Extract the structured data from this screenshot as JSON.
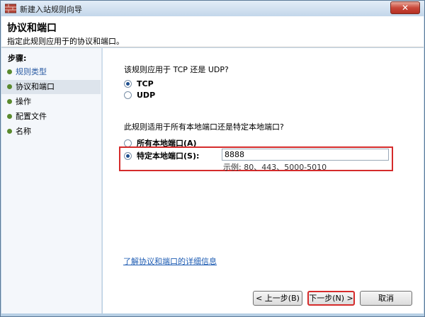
{
  "window": {
    "title": "新建入站规则向导",
    "close_glyph": "✕"
  },
  "header": {
    "title": "协议和端口",
    "subtitle": "指定此规则应用于的协议和端口。"
  },
  "steps": {
    "title": "步骤:",
    "items": [
      {
        "label": "规则类型",
        "state": "done"
      },
      {
        "label": "协议和端口",
        "state": "active"
      },
      {
        "label": "操作",
        "state": "pending"
      },
      {
        "label": "配置文件",
        "state": "pending"
      },
      {
        "label": "名称",
        "state": "pending"
      }
    ]
  },
  "protocol": {
    "question": "该规则应用于 TCP 还是 UDP?",
    "options": [
      {
        "label": "TCP",
        "checked": true
      },
      {
        "label": "UDP",
        "checked": false
      }
    ]
  },
  "ports": {
    "question": "此规则适用于所有本地端口还是特定本地端口?",
    "all_label": "所有本地端口(A)",
    "specific_label": "特定本地端口(S):",
    "value": "8888",
    "example": "示例: 80、443、5000-5010"
  },
  "link": {
    "learn_more": "了解协议和端口的详细信息"
  },
  "buttons": {
    "back": "< 上一步(B)",
    "next": "下一步(N) >",
    "cancel": "取消"
  },
  "colors": {
    "highlight": "#d52b2b",
    "link": "#1e5cb3",
    "step_dot": "#5a8a2e"
  }
}
